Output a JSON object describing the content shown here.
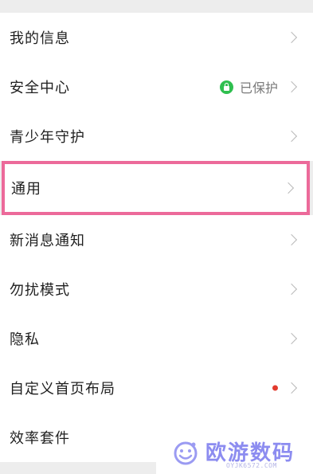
{
  "menu": {
    "items": [
      {
        "label": "我的信息"
      },
      {
        "label": "安全中心",
        "status": "已保护"
      },
      {
        "label": "青少年守护"
      },
      {
        "label": "通用"
      },
      {
        "label": "新消息通知"
      },
      {
        "label": "勿扰模式"
      },
      {
        "label": "隐私"
      },
      {
        "label": "自定义首页布局"
      },
      {
        "label": "效率套件"
      }
    ]
  },
  "colors": {
    "highlight_border": "#ec6a9a",
    "protected_icon": "#2fbf4f",
    "new_badge_dot": "#e23b2e"
  },
  "watermark": {
    "title": "欧游数码",
    "subtitle": "OYJK6572.COM"
  }
}
